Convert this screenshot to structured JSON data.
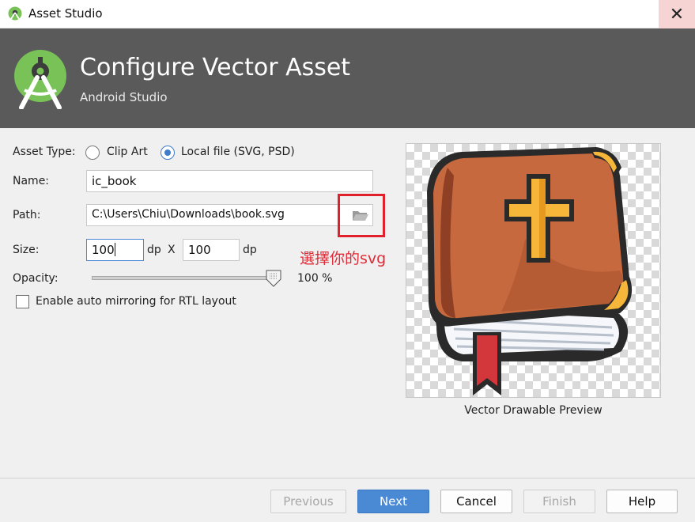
{
  "window": {
    "title": "Asset Studio",
    "close_glyph": "✕"
  },
  "banner": {
    "title": "Configure Vector Asset",
    "subtitle": "Android Studio"
  },
  "form": {
    "asset_type_label": "Asset Type:",
    "asset_type_options": [
      {
        "label": "Clip Art",
        "selected": false
      },
      {
        "label": "Local file (SVG, PSD)",
        "selected": true
      }
    ],
    "name_label": "Name:",
    "name_value": "ic_book",
    "path_label": "Path:",
    "path_value": "C:\\Users\\Chiu\\Downloads\\book.svg",
    "size_label": "Size:",
    "width_value": "100",
    "width_unit": "dp",
    "size_separator": "X",
    "height_value": "100",
    "height_unit": "dp",
    "opacity_label": "Opacity:",
    "opacity_value": "100 %",
    "opacity_fraction": 1.0,
    "rtl_label": "Enable auto mirroring for RTL layout",
    "rtl_checked": false
  },
  "annotation": {
    "text": "選擇你的svg",
    "color": "#e02a36"
  },
  "preview": {
    "caption": "Vector Drawable Preview"
  },
  "buttons": {
    "previous": "Previous",
    "next": "Next",
    "cancel": "Cancel",
    "finish": "Finish",
    "help": "Help"
  },
  "colors": {
    "accent": "#4a8ad4",
    "banner": "#5a5a5a",
    "android_green": "#78c257"
  }
}
